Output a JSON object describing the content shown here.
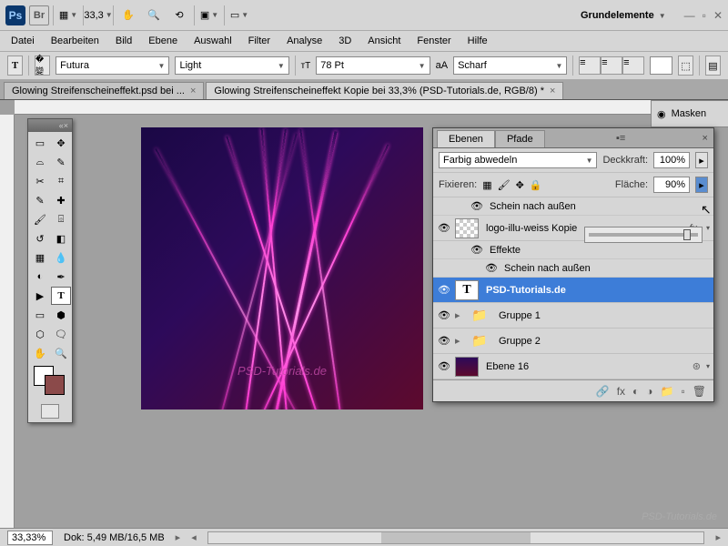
{
  "topbar": {
    "zoom": "33,3",
    "workspace": "Grundelemente"
  },
  "menu": [
    "Datei",
    "Bearbeiten",
    "Bild",
    "Ebene",
    "Auswahl",
    "Filter",
    "Analyse",
    "3D",
    "Ansicht",
    "Fenster",
    "Hilfe"
  ],
  "options": {
    "font": "Futura",
    "weight": "Light",
    "size": "78 Pt",
    "aa_label": "aA",
    "aa": "Scharf"
  },
  "tabs": [
    {
      "label": "Glowing Streifenscheineffekt.psd bei ...",
      "active": false
    },
    {
      "label": "Glowing Streifenscheineffekt Kopie bei 33,3% (PSD-Tutorials.de, RGB/8) *",
      "active": true
    }
  ],
  "canvas": {
    "watermark": "PSD-Tutorials.de"
  },
  "masks_panel": {
    "title": "Masken"
  },
  "layers_panel": {
    "tabs": [
      "Ebenen",
      "Pfade"
    ],
    "blend": "Farbig abwedeln",
    "opacity_label": "Deckkraft:",
    "opacity": "100%",
    "fix_label": "Fixieren:",
    "fill_label": "Fläche:",
    "fill": "90%",
    "effect_outer": "Schein nach außen",
    "layers": [
      {
        "name": "logo-illu-weiss Kopie",
        "fx": true,
        "thumb": "checker"
      },
      {
        "effects_label": "Effekte",
        "sub": "Schein nach außen"
      },
      {
        "name": "PSD-Tutorials.de",
        "selected": true,
        "thumb": "text"
      },
      {
        "name": "Gruppe 1",
        "thumb": "folder"
      },
      {
        "name": "Gruppe 2",
        "thumb": "folder"
      },
      {
        "name": "Ebene 16",
        "thumb": "dark"
      }
    ]
  },
  "status": {
    "zoom": "33,33%",
    "doc": "Dok: 5,49 MB/16,5 MB"
  },
  "page_watermark": "PSD-Tutorials.de"
}
